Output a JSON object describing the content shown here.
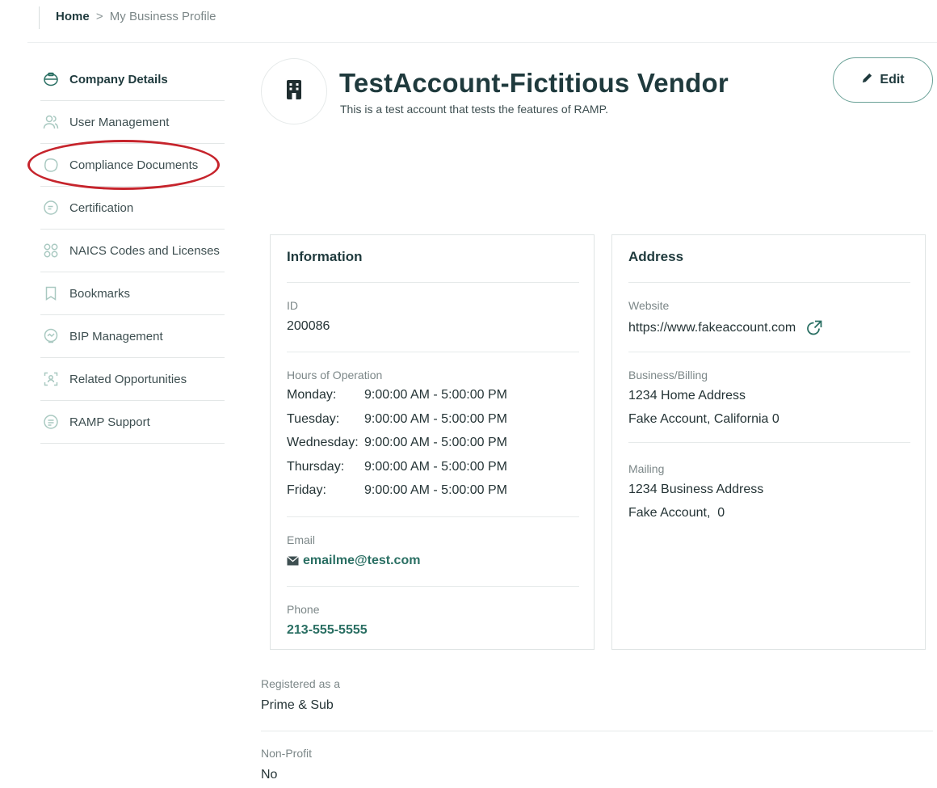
{
  "breadcrumb": {
    "home": "Home",
    "separator": ">",
    "current": "My Business Profile"
  },
  "sidebar": {
    "items": [
      {
        "label": "Company Details",
        "icon": "company-icon",
        "active": true
      },
      {
        "label": "User Management",
        "icon": "users-icon"
      },
      {
        "label": "Compliance Documents",
        "icon": "documents-icon"
      },
      {
        "label": "Certification",
        "icon": "certificate-icon"
      },
      {
        "label": "NAICS Codes and Licenses",
        "icon": "grid-icon"
      },
      {
        "label": "Bookmarks",
        "icon": "bookmark-icon"
      },
      {
        "label": "BIP Management",
        "icon": "bip-icon"
      },
      {
        "label": "Related Opportunities",
        "icon": "opportunities-icon"
      },
      {
        "label": "RAMP Support",
        "icon": "support-icon"
      }
    ]
  },
  "header": {
    "company_name": "TestAccount-Fictitious Vendor",
    "description": "This is a test account that tests the features of RAMP.",
    "edit_label": "Edit"
  },
  "information": {
    "title": "Information",
    "id_label": "ID",
    "id_value": "200086",
    "hours_label": "Hours of Operation",
    "hours": [
      {
        "day": "Monday:",
        "time": "9:00:00 AM - 5:00:00 PM"
      },
      {
        "day": "Tuesday:",
        "time": "9:00:00 AM - 5:00:00 PM"
      },
      {
        "day": "Wednesday:",
        "time": "9:00:00 AM - 5:00:00 PM"
      },
      {
        "day": "Thursday:",
        "time": "9:00:00 AM - 5:00:00 PM"
      },
      {
        "day": "Friday:",
        "time": "9:00:00 AM - 5:00:00 PM"
      }
    ],
    "email_label": "Email",
    "email_value": "emailme@test.com",
    "phone_label": "Phone",
    "phone_value": "213-555-5555"
  },
  "address": {
    "title": "Address",
    "website_label": "Website",
    "website_value": "https://www.fakeaccount.com",
    "billing_label": "Business/Billing",
    "billing_line1": "1234 Home Address",
    "billing_line2": "Fake Account, California 0",
    "mailing_label": "Mailing",
    "mailing_line1": "1234 Business Address",
    "mailing_line2": "Fake Account,  0"
  },
  "registration": {
    "registered_label": "Registered as a",
    "registered_value": "Prime & Sub",
    "nonprofit_label": "Non-Profit",
    "nonprofit_value": "No"
  },
  "colors": {
    "accent": "#2a6f63",
    "highlight": "#c6242c",
    "heading": "#1f3a3d"
  }
}
